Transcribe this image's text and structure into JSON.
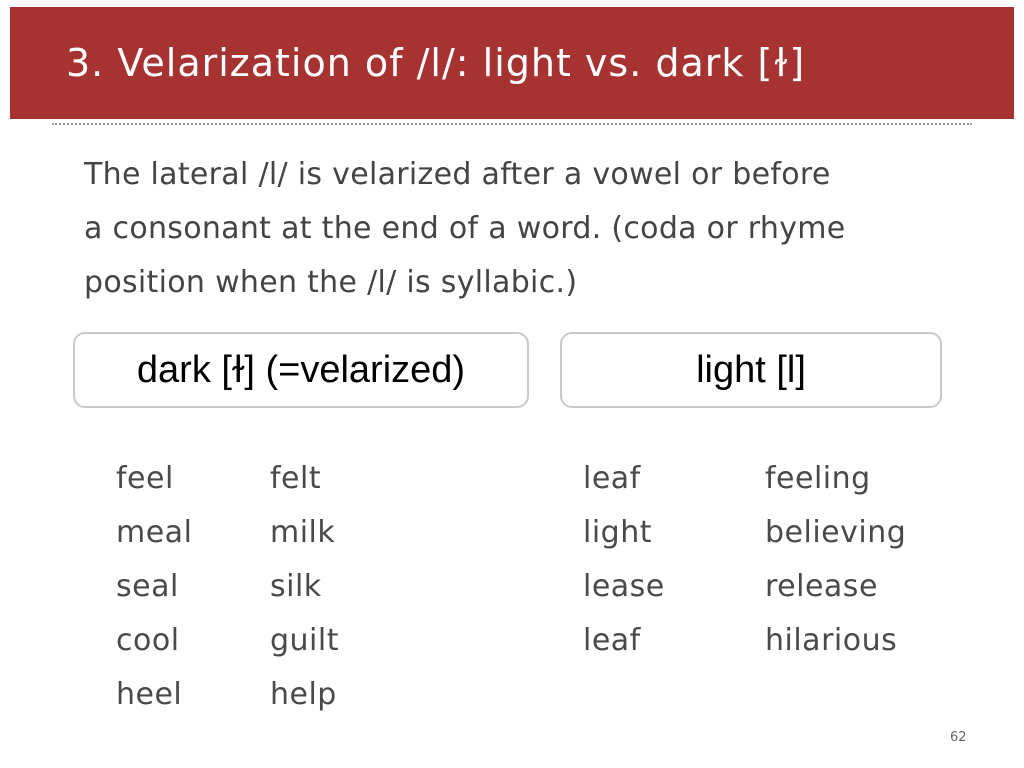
{
  "slide": {
    "title": "3. Velarization of /l/: light vs. dark [ɫ]",
    "intro_lines": [
      "The lateral /l/ is velarized after a vowel or before",
      "a consonant at the end of a word. (coda or rhyme",
      "position when the /l/ is syllabic.)"
    ],
    "dark_box_label": "dark [ɫ] (=velarized)",
    "light_box_label": "light [l]",
    "dark_words_col1": [
      "feel",
      "meal",
      "seal",
      "cool",
      "heel"
    ],
    "dark_words_col2": [
      "felt",
      "milk",
      "silk",
      "guilt",
      "help"
    ],
    "light_words_col1": [
      "leaf",
      "light",
      "lease",
      "leaf"
    ],
    "light_words_col2": [
      "feeling",
      "believing",
      "release",
      "hilarious"
    ],
    "page_number": "62"
  },
  "colors": {
    "title_bar": "#a63332",
    "title_text": "#ffffff",
    "body_text": "#444444",
    "box_border": "#c9c9c9"
  }
}
